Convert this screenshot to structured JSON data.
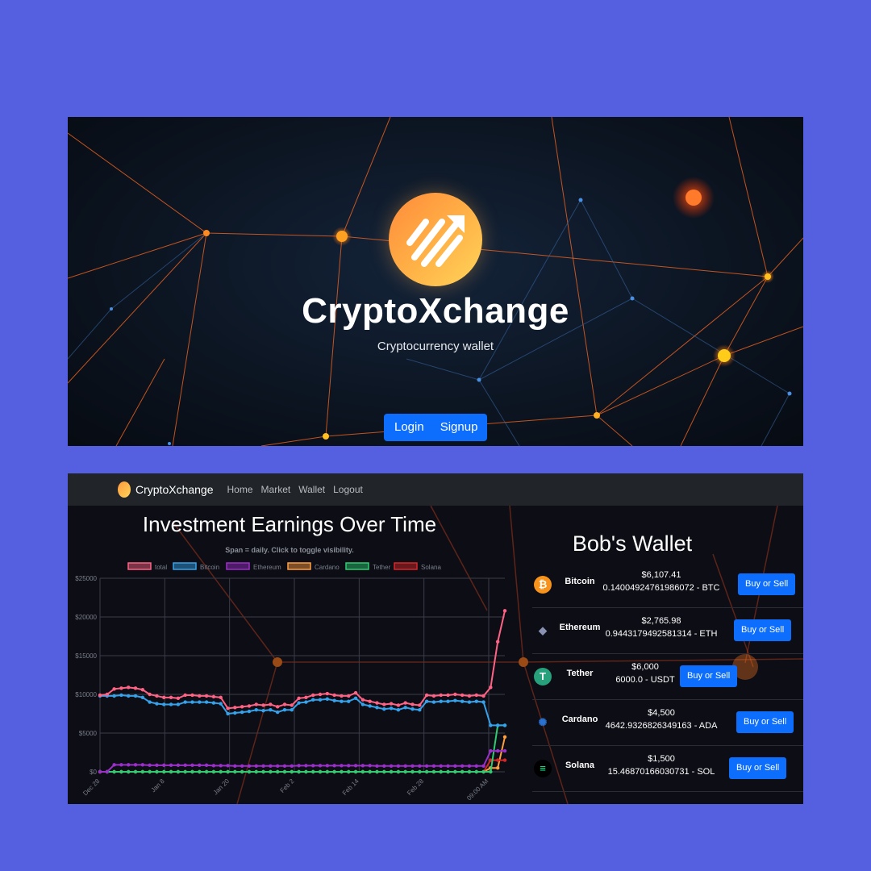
{
  "hero": {
    "title": "CryptoXchange",
    "subtitle": "Cryptocurrency wallet",
    "login_label": "Login",
    "signup_label": "Signup"
  },
  "navbar": {
    "brand": "CryptoXchange",
    "links": [
      "Home",
      "Market",
      "Wallet",
      "Logout"
    ]
  },
  "chart": {
    "title": "Investment Earnings Over Time",
    "note": "Span = daily. Click to toggle visibility."
  },
  "chart_data": {
    "type": "line",
    "legend_position": "top",
    "grid": true,
    "ylim": [
      0,
      25000
    ],
    "yticks": [
      "$0",
      "$5000",
      "$10000",
      "$15000",
      "$20000",
      "$25000"
    ],
    "xticks": [
      "Dec 28",
      "Jan 8",
      "Jan 20",
      "Feb 2",
      "Feb 14",
      "Feb 28",
      "09:00 AM"
    ],
    "series": [
      {
        "name": "total",
        "color": "#ff6384",
        "values": [
          9900,
          10000,
          10700,
          10800,
          10900,
          10800,
          10600,
          10000,
          9800,
          9600,
          9600,
          9500,
          9900,
          9900,
          9800,
          9800,
          9700,
          9600,
          8200,
          8300,
          8400,
          8500,
          8700,
          8600,
          8700,
          8400,
          8700,
          8600,
          9500,
          9600,
          9900,
          10000,
          10100,
          9900,
          9800,
          9800,
          10200,
          9300,
          9100,
          8900,
          8700,
          8800,
          8600,
          8900,
          8700,
          8600,
          9900,
          9800,
          9900,
          9900,
          10000,
          9900,
          9800,
          9900,
          9800,
          10900,
          16800,
          20800
        ]
      },
      {
        "name": "Bitcoin",
        "color": "#36a2eb",
        "values": [
          9800,
          9800,
          9800,
          9900,
          9800,
          9800,
          9600,
          9000,
          8800,
          8700,
          8700,
          8700,
          9000,
          9000,
          9000,
          9000,
          8900,
          8800,
          7500,
          7600,
          7700,
          7800,
          8000,
          7900,
          8000,
          7700,
          8000,
          8000,
          8900,
          9000,
          9300,
          9300,
          9400,
          9200,
          9100,
          9100,
          9500,
          8700,
          8500,
          8300,
          8100,
          8200,
          8000,
          8300,
          8100,
          8000,
          9100,
          9000,
          9100,
          9100,
          9200,
          9100,
          9000,
          9100,
          9000,
          6000,
          6000,
          6000
        ]
      },
      {
        "name": "Ethereum",
        "color": "#9b2fc9",
        "values": [
          0,
          0,
          900,
          900,
          900,
          900,
          900,
          850,
          850,
          850,
          850,
          850,
          850,
          850,
          850,
          850,
          800,
          800,
          800,
          750,
          750,
          750,
          750,
          750,
          750,
          750,
          750,
          750,
          800,
          800,
          800,
          800,
          800,
          800,
          800,
          800,
          800,
          800,
          800,
          750,
          750,
          750,
          750,
          750,
          750,
          750,
          750,
          750,
          750,
          750,
          750,
          750,
          750,
          750,
          750,
          2700,
          2700,
          2700
        ]
      },
      {
        "name": "Cardano",
        "color": "#ff9f40",
        "values": [
          0,
          0,
          0,
          0,
          0,
          0,
          0,
          0,
          0,
          0,
          0,
          0,
          0,
          0,
          0,
          0,
          0,
          0,
          0,
          0,
          0,
          0,
          0,
          0,
          0,
          0,
          0,
          0,
          0,
          0,
          0,
          0,
          0,
          0,
          0,
          0,
          0,
          0,
          0,
          0,
          0,
          0,
          0,
          0,
          0,
          0,
          0,
          0,
          0,
          0,
          0,
          0,
          0,
          0,
          0,
          500,
          500,
          4500
        ]
      },
      {
        "name": "Tether",
        "color": "#2ecc71",
        "values": [
          0,
          0,
          0,
          0,
          0,
          0,
          0,
          0,
          0,
          0,
          0,
          0,
          0,
          0,
          0,
          0,
          0,
          0,
          0,
          0,
          0,
          0,
          0,
          0,
          0,
          0,
          0,
          0,
          0,
          0,
          0,
          0,
          0,
          0,
          0,
          0,
          0,
          0,
          0,
          0,
          0,
          0,
          0,
          0,
          0,
          0,
          0,
          0,
          0,
          0,
          0,
          0,
          0,
          0,
          0,
          0,
          6000,
          6000
        ]
      },
      {
        "name": "Solana",
        "color": "#d62728",
        "values": [
          0,
          0,
          0,
          0,
          0,
          0,
          0,
          0,
          0,
          0,
          0,
          0,
          0,
          0,
          0,
          0,
          0,
          0,
          0,
          0,
          0,
          0,
          0,
          0,
          0,
          0,
          0,
          0,
          0,
          0,
          0,
          0,
          0,
          0,
          0,
          0,
          0,
          0,
          0,
          0,
          0,
          0,
          0,
          0,
          0,
          0,
          0,
          0,
          0,
          0,
          0,
          0,
          0,
          0,
          0,
          1500,
          1500,
          1500
        ]
      }
    ]
  },
  "wallet": {
    "title": "Bob's Wallet",
    "button_label": "Buy or Sell",
    "coins": [
      {
        "name": "Bitcoin",
        "value": "$6,107.41",
        "amount": "0.14004924761986072 - BTC",
        "icon": "bitcoin-icon",
        "color": "#f7931a"
      },
      {
        "name": "Ethereum",
        "value": "$2,765.98",
        "amount": "0.9443179492581314 - ETH",
        "icon": "ethereum-icon",
        "color": "#8a92b2"
      },
      {
        "name": "Tether",
        "value": "$6,000",
        "amount": "6000.0 - USDT",
        "icon": "tether-icon",
        "color": "#26a17b"
      },
      {
        "name": "Cardano",
        "value": "$4,500",
        "amount": "4642.9326826349163 - ADA",
        "icon": "cardano-icon",
        "color": "#2a71d0"
      },
      {
        "name": "Solana",
        "value": "$1,500",
        "amount": "15.46870166030731 - SOL",
        "icon": "solana-icon",
        "color": "#14f195"
      }
    ]
  }
}
